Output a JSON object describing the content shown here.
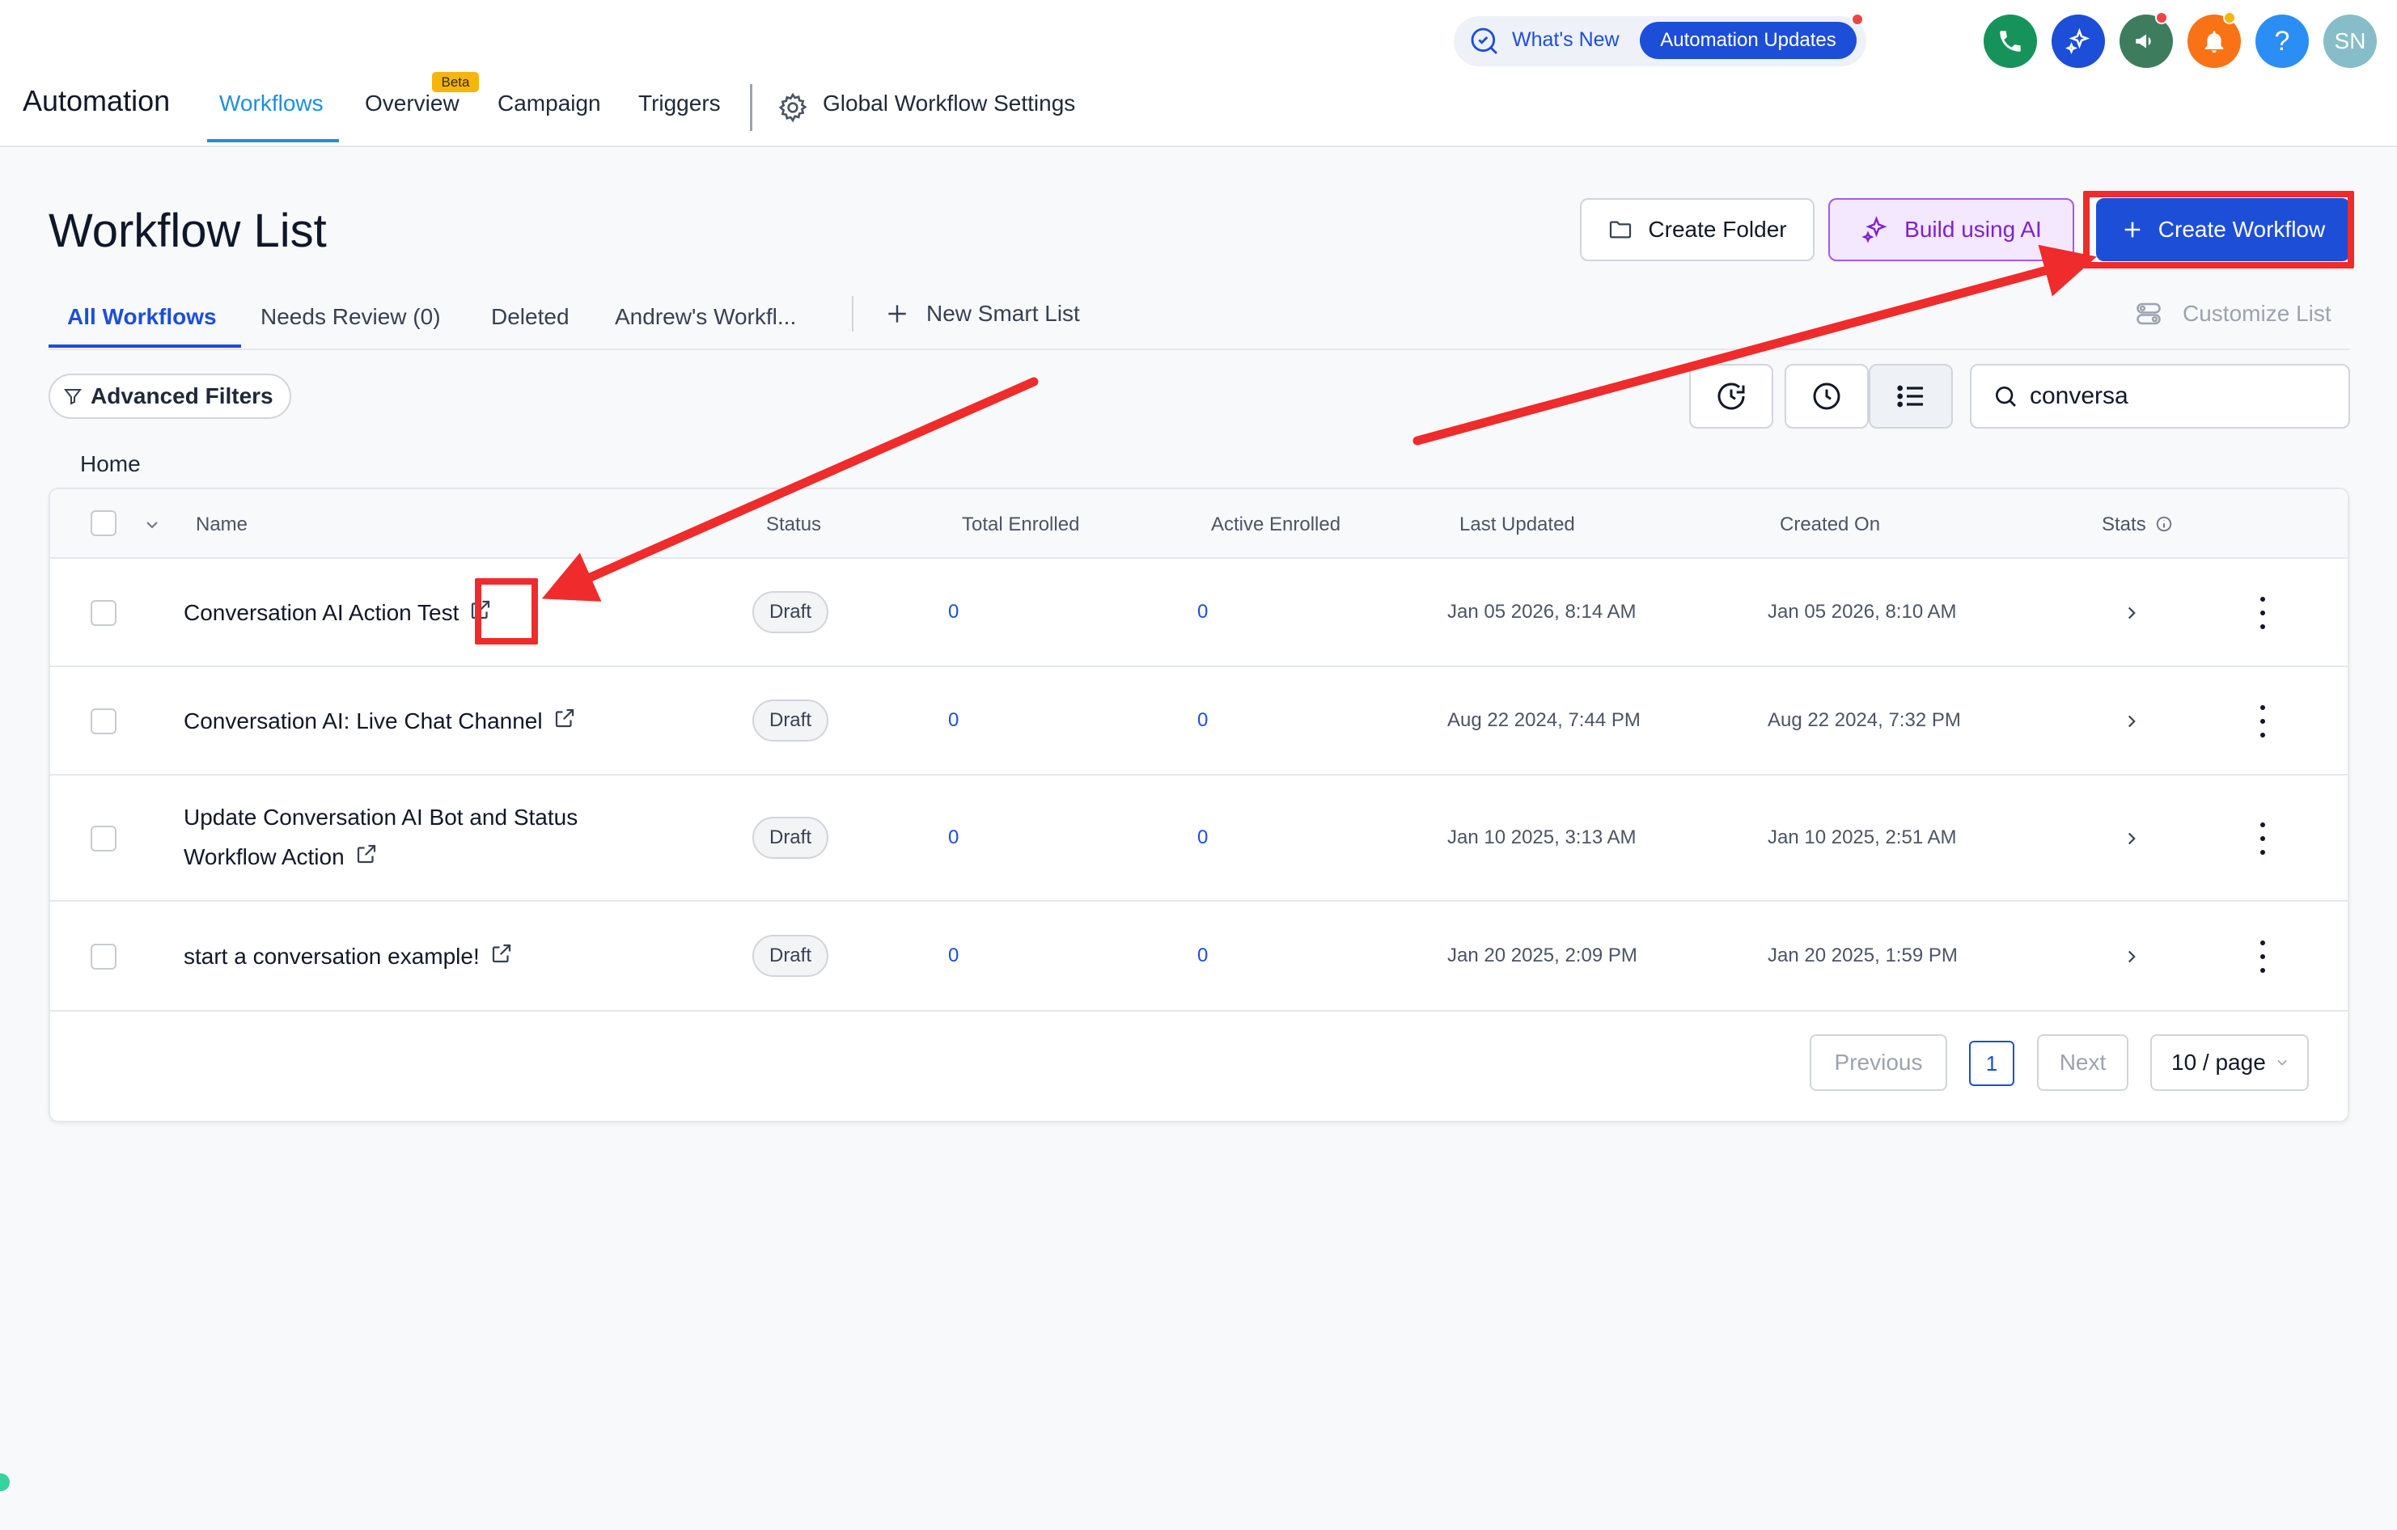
{
  "app": {
    "title": "Automation",
    "nav": {
      "workflows": "Workflows",
      "overview": "Overview",
      "beta": "Beta",
      "campaign": "Campaign",
      "triggers": "Triggers",
      "settings": "Global Workflow Settings"
    },
    "whats_new": "What's New",
    "automation_updates": "Automation Updates",
    "avatar_initials": "SN",
    "help_symbol": "?",
    "header_buttons": [
      {
        "name": "phone",
        "color": "#15935a"
      },
      {
        "name": "ai-sparkle",
        "color": "#1d4ed8"
      },
      {
        "name": "megaphone",
        "color": "#3d7d5e"
      },
      {
        "name": "bell",
        "color": "#f97316"
      },
      {
        "name": "help",
        "color": "#2b8ef5"
      },
      {
        "name": "avatar",
        "color": "#86bdc8"
      }
    ]
  },
  "page": {
    "title": "Workflow List",
    "create_folder": "Create Folder",
    "build_ai": "Build using AI",
    "create_workflow": "Create Workflow",
    "tabs": {
      "all": "All Workflows",
      "needs_review": "Needs Review (0)",
      "deleted": "Deleted",
      "andrew": "Andrew's Workfl...",
      "new_smart_list": "New Smart List"
    },
    "customize_list": "Customize List",
    "advanced_filters": "Advanced Filters",
    "search_value": "conversa",
    "breadcrumb": "Home"
  },
  "table": {
    "headers": {
      "name": "Name",
      "status": "Status",
      "total_enrolled": "Total Enrolled",
      "active_enrolled": "Active Enrolled",
      "last_updated": "Last Updated",
      "created_on": "Created On",
      "stats": "Stats"
    },
    "rows": [
      {
        "name": "Conversation AI Action Test",
        "status": "Draft",
        "total": "0",
        "active": "0",
        "updated": "Jan 05 2026, 8:14 AM",
        "created": "Jan 05 2026, 8:10 AM"
      },
      {
        "name": "Conversation AI: Live Chat Channel",
        "status": "Draft",
        "total": "0",
        "active": "0",
        "updated": "Aug 22 2024, 7:44 PM",
        "created": "Aug 22 2024, 7:32 PM"
      },
      {
        "name_line1": "Update Conversation AI Bot and Status",
        "name_line2": "Workflow Action",
        "status": "Draft",
        "total": "0",
        "active": "0",
        "updated": "Jan 10 2025, 3:13 AM",
        "created": "Jan 10 2025, 2:51 AM"
      },
      {
        "name": "start a conversation example!",
        "status": "Draft",
        "total": "0",
        "active": "0",
        "updated": "Jan 20 2025, 2:09 PM",
        "created": "Jan 20 2025, 1:59 PM"
      }
    ]
  },
  "pagination": {
    "previous": "Previous",
    "page": "1",
    "next": "Next",
    "per_page": "10 / page"
  },
  "annotations": {
    "highlight_color": "#ef2b2b"
  }
}
